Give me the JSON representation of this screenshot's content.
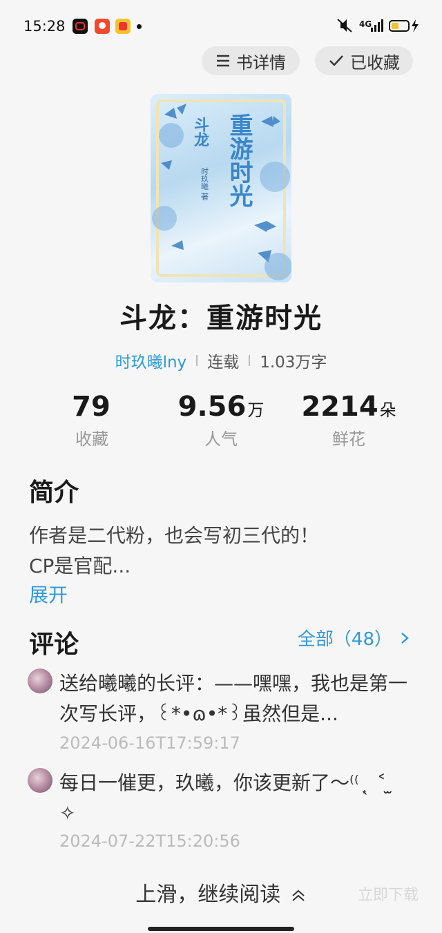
{
  "status_bar": {
    "time": "15:28",
    "network": "4G"
  },
  "top_actions": {
    "details_label": "书详情",
    "collected_label": "已收藏"
  },
  "book": {
    "cover_title": "重游时光",
    "cover_subtitle": "斗龙",
    "cover_author": "时玖曦 著",
    "title": "斗龙：重游时光",
    "author": "时玖曦lny",
    "status": "连载",
    "word_count": "1.03万字"
  },
  "stats": [
    {
      "value": "79",
      "unit": "",
      "label": "收藏"
    },
    {
      "value": "9.56",
      "unit": "万",
      "label": "人气"
    },
    {
      "value": "2214",
      "unit": "朵",
      "label": "鲜花"
    }
  ],
  "intro": {
    "heading": "简介",
    "line1": "作者是二代粉，也会写初三代的！",
    "line2": "CP是官配...",
    "expand_label": "展开"
  },
  "comments": {
    "heading": "评论",
    "all_label": "全部（48）",
    "items": [
      {
        "text": "送给曦曦的长评：——嘿嘿，我也是第一次写长评，꒰*•ɷ•*꒱虽然但是...",
        "time": "2024-06-16T17:59:17"
      },
      {
        "text": "每日一催更，玖曦，你该更新了～⁽⁽ ͙ ̖ ˂ ̫ ✧",
        "time": "2024-07-22T15:20:56"
      }
    ]
  },
  "footer": {
    "continue_label": "上滑，继续阅读",
    "download_label": "立即下载"
  },
  "colors": {
    "accent": "#2f9ad8",
    "background": "#f6f6f6"
  }
}
